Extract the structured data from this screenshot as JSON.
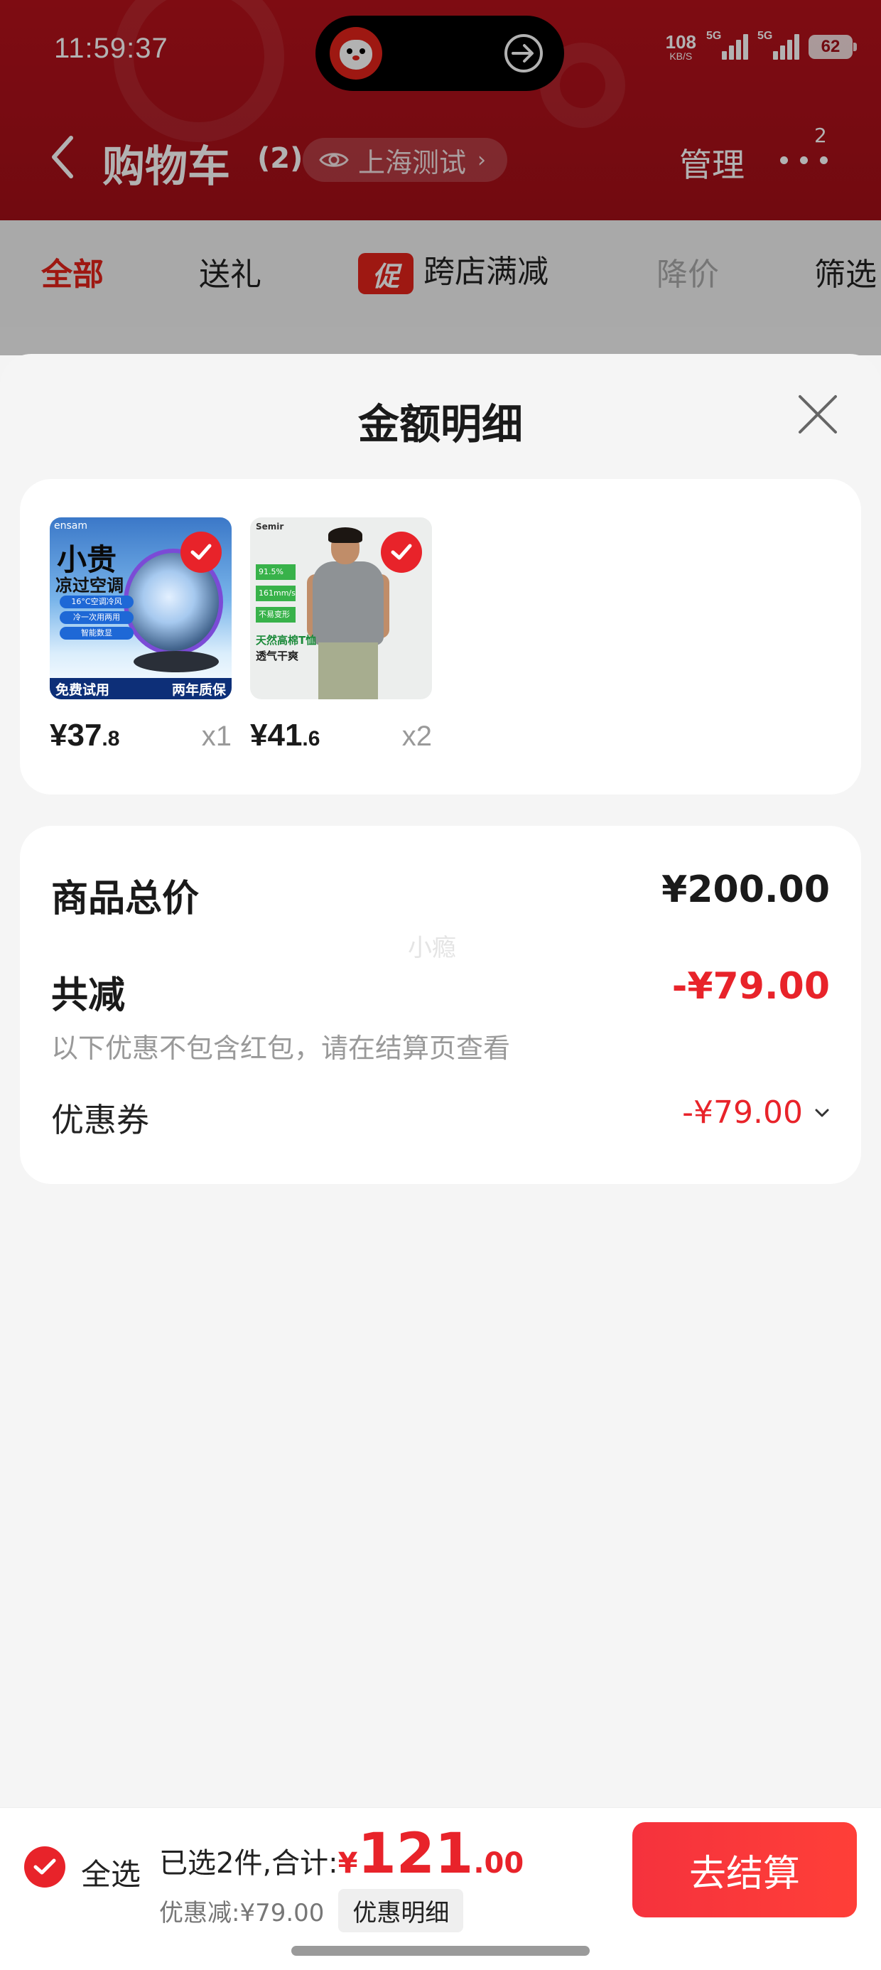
{
  "status_bar": {
    "time": "11:59:37",
    "net_speed": "108",
    "net_unit": "KB/S",
    "signal1_tag": "5G",
    "signal2_tag": "5G",
    "battery": "62"
  },
  "header": {
    "title": "购物车",
    "count": "(2)",
    "location": "上海测试",
    "manage": "管理",
    "more_badge": "2"
  },
  "tabs": {
    "all": "全部",
    "gift": "送礼",
    "promo_icon": "促",
    "cross_store": "跨店满减",
    "price_drop": "降价",
    "filter": "筛选"
  },
  "sheet": {
    "title": "金额明细",
    "products": [
      {
        "price_int": "¥37",
        "price_dec": ".8",
        "qty": "x1",
        "image": {
          "brand": "ensam",
          "title": "小贵",
          "subtitle": "凉过空调",
          "chips": [
            "16°C空调冷风",
            "冷一次用两用",
            "智能数显"
          ],
          "badge_left": "免费试用",
          "badge_right": "两年质保"
        }
      },
      {
        "price_int": "¥41",
        "price_dec": ".6",
        "qty": "x2",
        "image": {
          "brand": "Semir",
          "tags": [
            "91.5%",
            "161mm/s",
            "不易变形"
          ],
          "copy1": "天然高棉T恤",
          "copy2": "透气干爽"
        }
      }
    ],
    "summary": {
      "total_label": "商品总价",
      "total_value": "¥200.00",
      "reduce_label": "共减",
      "reduce_value": "-¥79.00",
      "note": "以下优惠不包含红包，请在结算页查看",
      "coupon_label": "优惠券",
      "coupon_value": "-¥79.00",
      "watermark": "小瘾"
    }
  },
  "checkout": {
    "select_all": "全选",
    "selected_text": "已选2件,合计:",
    "currency": "¥",
    "total_int": "121",
    "total_dec": ".00",
    "discount_text": "优惠减:¥79.00",
    "detail_button": "优惠明细",
    "checkout_button": "去结算"
  },
  "colors": {
    "brand_red": "#e8232a",
    "header_red": "#a30f18"
  }
}
